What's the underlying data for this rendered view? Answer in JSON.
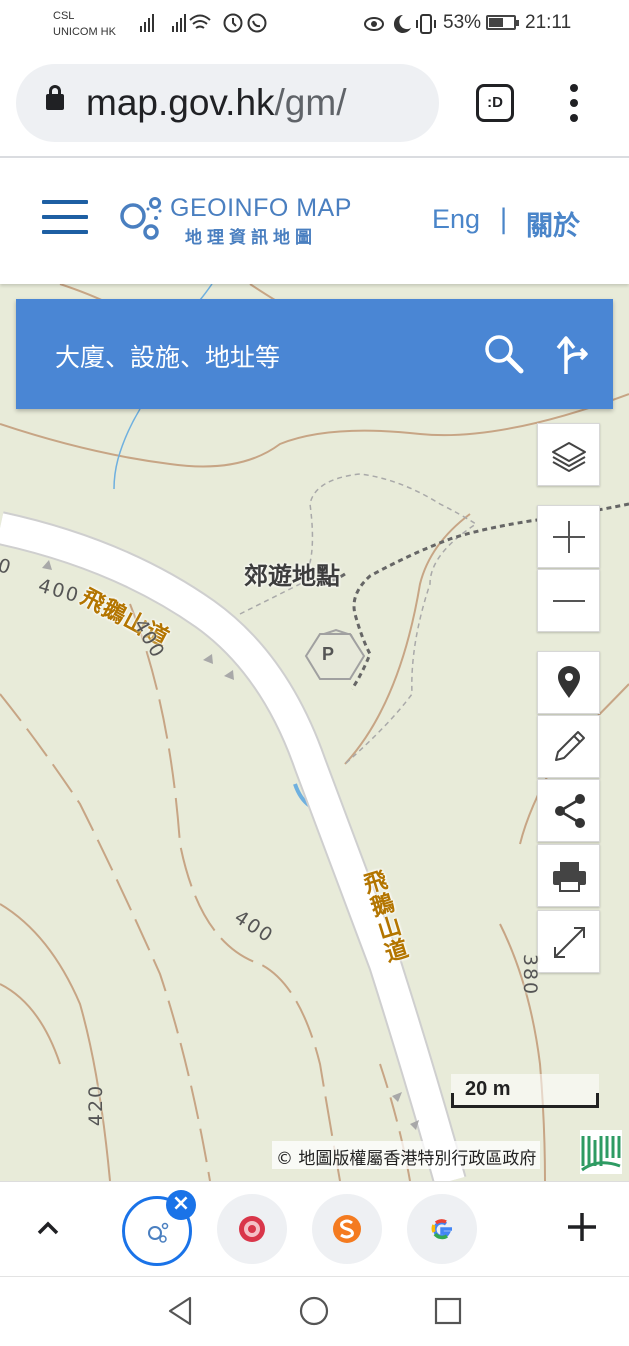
{
  "status_bar": {
    "carrier_line1": "CSL",
    "carrier_line2": "UNICOM HK",
    "battery": "53%",
    "battery_level": 0.53,
    "time": "21:11"
  },
  "browser": {
    "url_host": "map.gov.hk",
    "url_path": "/gm/",
    "tab_switcher_label": ":D"
  },
  "site_header": {
    "logo_en": "GEOINFO MAP",
    "logo_zh": "地理資訊地圖",
    "lang_link": "Eng",
    "separator": "|",
    "about_link": "關於"
  },
  "search": {
    "placeholder": "大廈、設施、地址等"
  },
  "map": {
    "place_label": "郊遊地點",
    "parking_label": "P",
    "road_label_1": "飛鵝山道",
    "road_label_2": "飛鵝山道",
    "contours": [
      "0",
      "400",
      "400",
      "400",
      "420",
      "380"
    ],
    "scale": "20 m",
    "copyright": "© 地圖版權屬香港特別行政區政府"
  },
  "colors": {
    "accent": "#4a86d4",
    "brand": "#4a7fc0",
    "road_label": "#b37500",
    "map_bg": "#e8ebd9"
  }
}
